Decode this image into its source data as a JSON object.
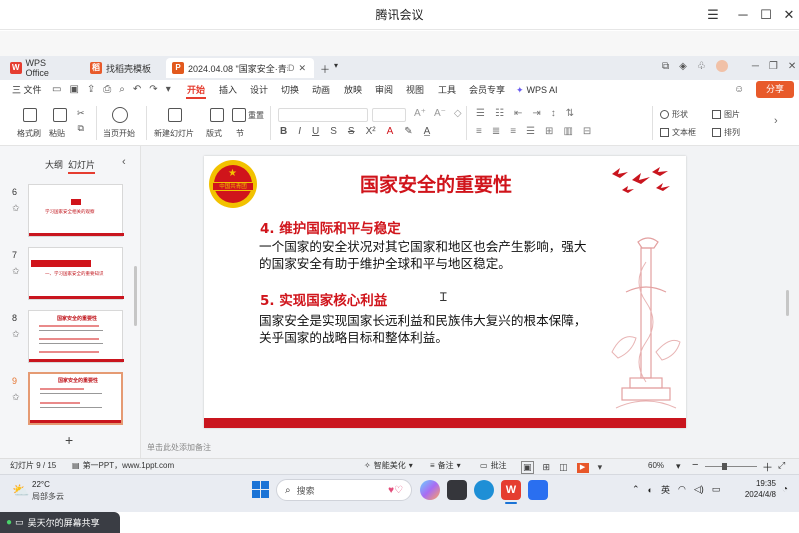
{
  "meeting": {
    "title": "腾讯会议"
  },
  "tabs": [
    {
      "label": "WPS Office"
    },
    {
      "label": "找稻壳模板"
    },
    {
      "label": "2024.04.08 \"国家安全·青春",
      "extra": "D"
    }
  ],
  "menu": {
    "file": "三 文件",
    "items": [
      "开始",
      "插入",
      "设计",
      "切换",
      "动画",
      "放映",
      "审阅",
      "视图",
      "工具",
      "会员专享"
    ],
    "wps_ai": "WPS AI",
    "share": "分享"
  },
  "ribbon": {
    "format_painter": "格式刷",
    "paste": "粘贴",
    "play_from_current": "当页开始",
    "new_slide": "新建幻灯片",
    "layout": "版式",
    "section": "节",
    "reset": "重置",
    "shape": "形状",
    "picture": "图片",
    "textbox": "文本框",
    "arrange": "排列"
  },
  "left_panel": {
    "tab_outline": "大纲",
    "tab_slides": "幻灯片",
    "thumbs": [
      {
        "num": "6",
        "text": "学习国家安全相关的观察"
      },
      {
        "num": "7",
        "text": "一、学习国家安全的重要知识"
      },
      {
        "num": "8",
        "text": "国家安全的重要性"
      },
      {
        "num": "9",
        "text": "国家安全的重要性"
      }
    ],
    "add": "+"
  },
  "slide": {
    "title": "国家安全的重要性",
    "logo_text": "中国共青团",
    "sections": [
      {
        "heading": "4. 维护国际和平与稳定",
        "lines": [
          "一个国家的安全状况对其它国家和地区也会产生影响，强大",
          "的国家安全有助于维护全球和平与地区稳定。"
        ]
      },
      {
        "heading": "5. 实现国家核心利益",
        "lines": [
          "国家安全是实现国家长远利益和民族伟大复兴的根本保障，",
          "关乎国家的战略目标和整体利益。"
        ]
      }
    ]
  },
  "notes_placeholder": "单击此处添加备注",
  "status": {
    "slide_counter": "幻灯片 9 / 15",
    "theme": "第一PPT，www.1ppt.com",
    "smart_beautify": "智能美化",
    "notes": "备注",
    "comments": "批注",
    "zoom": "60%"
  },
  "taskbar": {
    "weather_temp": "22°C",
    "weather_desc": "局部多云",
    "search": "搜索",
    "lang": "英",
    "time": "19:35",
    "date": "2024/4/8"
  },
  "share_banner": "吴天尔的屏幕共享",
  "colors": {
    "accent": "#d0141b",
    "share_button": "#e85a2a"
  }
}
